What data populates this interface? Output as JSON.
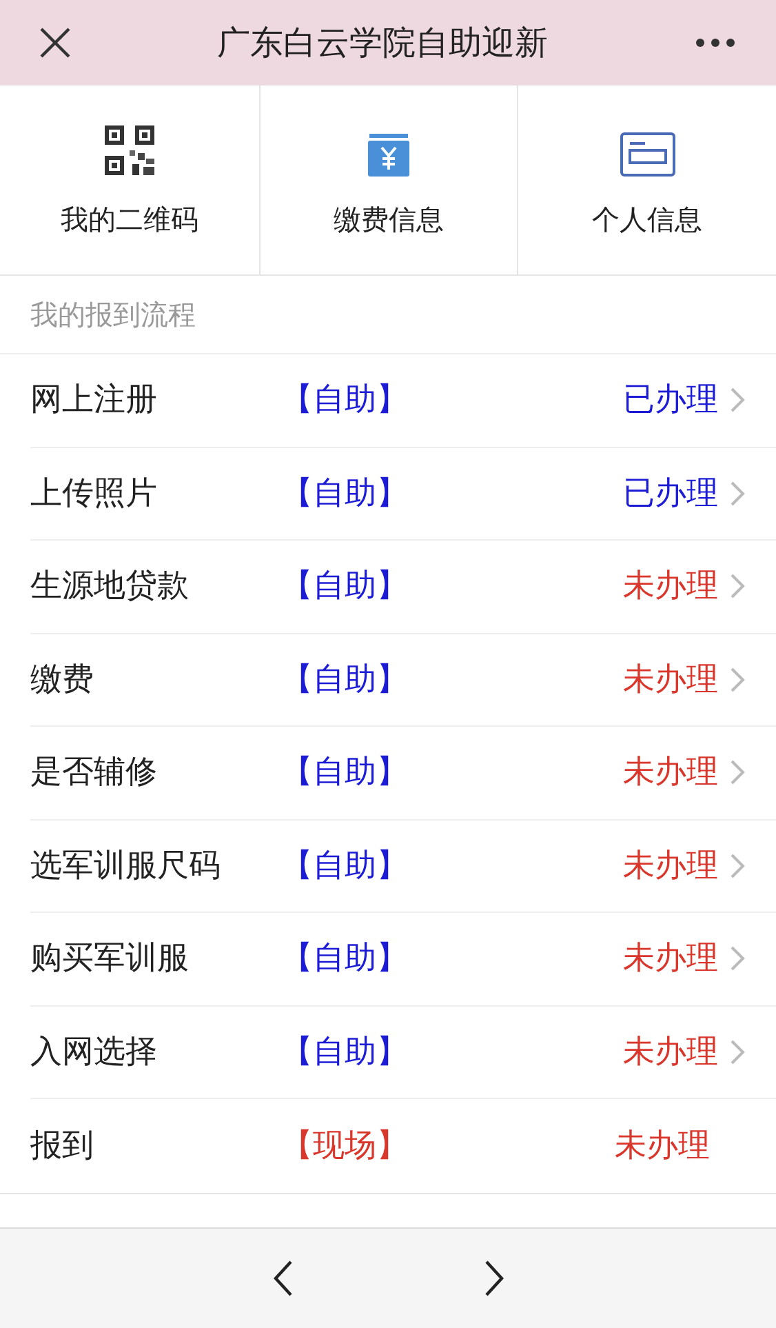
{
  "header": {
    "title": "广东白云学院自助迎新"
  },
  "shortcuts": [
    {
      "label": "我的二维码",
      "kind": "qr"
    },
    {
      "label": "缴费信息",
      "kind": "fee"
    },
    {
      "label": "个人信息",
      "kind": "card"
    }
  ],
  "section": {
    "title": "我的报到流程"
  },
  "steps": [
    {
      "name": "网上注册",
      "mode": {
        "text": "【自助】",
        "kind": "self"
      },
      "status": {
        "text": "已办理",
        "kind": "done"
      },
      "has_arrow": true
    },
    {
      "name": "上传照片",
      "mode": {
        "text": "【自助】",
        "kind": "self"
      },
      "status": {
        "text": "已办理",
        "kind": "done"
      },
      "has_arrow": true
    },
    {
      "name": "生源地贷款",
      "mode": {
        "text": "【自助】",
        "kind": "self"
      },
      "status": {
        "text": "未办理",
        "kind": "pending"
      },
      "has_arrow": true
    },
    {
      "name": "缴费",
      "mode": {
        "text": "【自助】",
        "kind": "self"
      },
      "status": {
        "text": "未办理",
        "kind": "pending"
      },
      "has_arrow": true
    },
    {
      "name": "是否辅修",
      "mode": {
        "text": "【自助】",
        "kind": "self"
      },
      "status": {
        "text": "未办理",
        "kind": "pending"
      },
      "has_arrow": true
    },
    {
      "name": "选军训服尺码",
      "mode": {
        "text": "【自助】",
        "kind": "self"
      },
      "status": {
        "text": "未办理",
        "kind": "pending"
      },
      "has_arrow": true
    },
    {
      "name": "购买军训服",
      "mode": {
        "text": "【自助】",
        "kind": "self"
      },
      "status": {
        "text": "未办理",
        "kind": "pending"
      },
      "has_arrow": true
    },
    {
      "name": "入网选择",
      "mode": {
        "text": "【自助】",
        "kind": "self"
      },
      "status": {
        "text": "未办理",
        "kind": "pending"
      },
      "has_arrow": true
    },
    {
      "name": "报到",
      "mode": {
        "text": "【现场】",
        "kind": "onsite"
      },
      "status": {
        "text": "未办理",
        "kind": "pending"
      },
      "has_arrow": false
    }
  ]
}
